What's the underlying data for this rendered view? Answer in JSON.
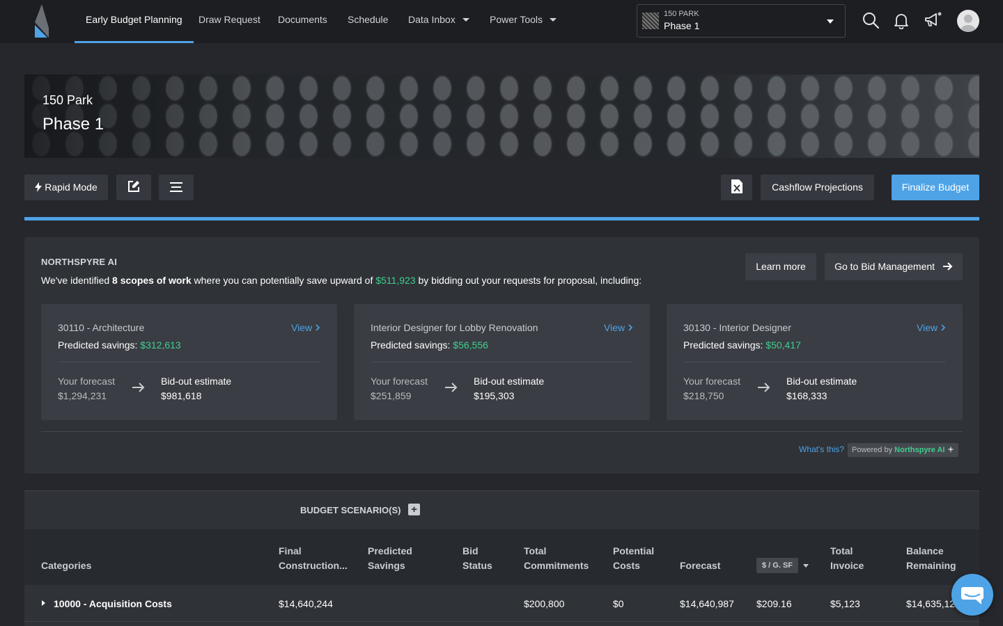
{
  "nav": {
    "tabs": [
      "Early Budget Planning",
      "Draw Request",
      "Documents",
      "Schedule",
      "Data Inbox",
      "Power Tools"
    ],
    "active_tab": "Early Budget Planning",
    "project_selector": {
      "project": "150 PARK",
      "phase": "Phase 1"
    },
    "icons": [
      "search-icon",
      "bell-icon",
      "megaphone-icon",
      "avatar"
    ]
  },
  "banner": {
    "project": "150 Park",
    "phase": "Phase 1"
  },
  "toolbar": {
    "rapid_mode": "Rapid Mode",
    "cashflow": "Cashflow Projections",
    "finalize": "Finalize Budget",
    "icons": [
      "bolt-icon",
      "edit-icon",
      "menu-icon",
      "excel-icon"
    ]
  },
  "ai": {
    "heading": "NORTHSPYRE AI",
    "desc_pre": "We've identified ",
    "desc_bold": "8 scopes of work",
    "desc_mid": " where you can potentially save upward of ",
    "desc_amount": "$511,923",
    "desc_post": " by bidding out your requests for proposal, including:",
    "learn_more": "Learn more",
    "bid_mgmt": "Go to Bid Management",
    "savings_label": "Predicted savings: ",
    "forecast_label": "Your forecast",
    "bidout_label": "Bid-out estimate",
    "view_label": "View",
    "cards": [
      {
        "title": "30110 - Architecture",
        "savings": "$312,613",
        "forecast": "$1,294,231",
        "bidout": "$981,618"
      },
      {
        "title": "Interior Designer for Lobby Renovation",
        "savings": "$56,556",
        "forecast": "$251,859",
        "bidout": "$195,303"
      },
      {
        "title": "30130 - Interior Designer",
        "savings": "$50,417",
        "forecast": "$218,750",
        "bidout": "$168,333"
      }
    ],
    "whats_this": "What's this?",
    "powered_pre": "Powered by ",
    "powered_brand": "Northspyre AI",
    "accent_color": "#3ecf8e"
  },
  "table": {
    "scenarios_label": "BUDGET SCENARIO(S)",
    "headers": {
      "categories": "Categories",
      "final_construction_1": "Final",
      "final_construction_2": "Construction...",
      "predicted_savings_1": "Predicted",
      "predicted_savings_2": "Savings",
      "bid_status_1": "Bid",
      "bid_status_2": "Status",
      "total_commitments_1": "Total",
      "total_commitments_2": "Commitments",
      "potential_costs_1": "Potential",
      "potential_costs_2": "Costs",
      "forecast": "Forecast",
      "unit": "$ / G. SF",
      "total_invoice_1": "Total",
      "total_invoice_2": "Invoice",
      "balance_remaining_1": "Balance",
      "balance_remaining_2": "Remaining"
    },
    "rows": [
      {
        "category": "10000 - Acquisition Costs",
        "final_construction": "$14,640,244",
        "predicted_savings": "",
        "bid_status": "",
        "total_commitments": "$200,800",
        "potential_costs": "$0",
        "forecast": "$14,640,987",
        "unit_value": "$209.16",
        "total_invoice": "$5,123",
        "balance_remaining": "$14,635,12"
      }
    ]
  },
  "colors": {
    "accent": "#4ea3e6",
    "background": "#25272c",
    "nav": "#1c1e22"
  }
}
